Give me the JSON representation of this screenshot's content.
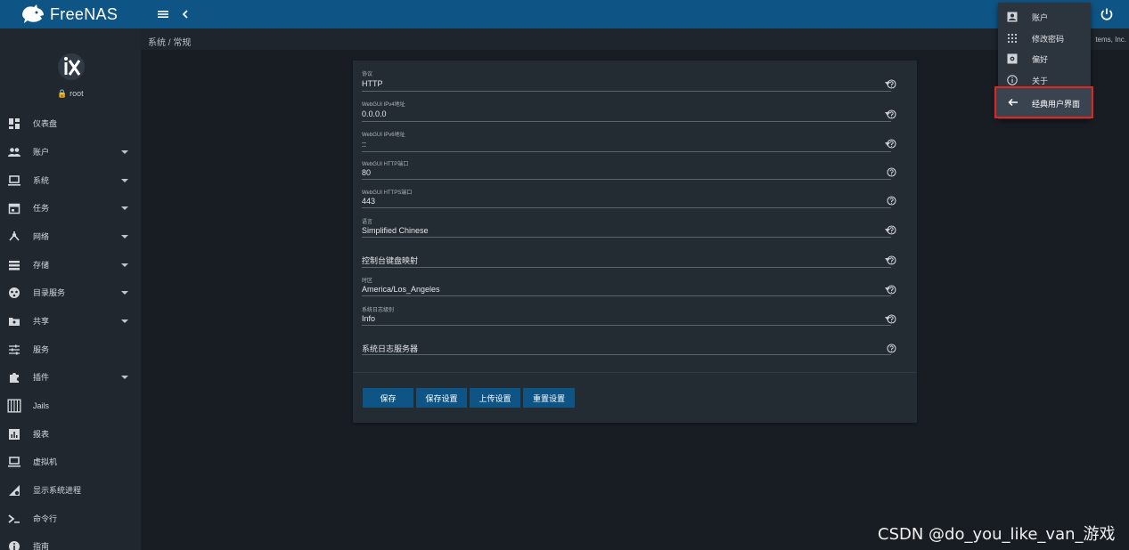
{
  "app": {
    "brand": "FreeNAS"
  },
  "sidebar": {
    "user": "root",
    "items": [
      {
        "label": "仪表盘",
        "icon": "dashboard-icon",
        "caret": false
      },
      {
        "label": "账户",
        "icon": "accounts-icon",
        "caret": true
      },
      {
        "label": "系统",
        "icon": "system-icon",
        "caret": true
      },
      {
        "label": "任务",
        "icon": "tasks-icon",
        "caret": true
      },
      {
        "label": "网络",
        "icon": "network-icon",
        "caret": true
      },
      {
        "label": "存储",
        "icon": "storage-icon",
        "caret": true
      },
      {
        "label": "目录服务",
        "icon": "directory-services-icon",
        "caret": true
      },
      {
        "label": "共享",
        "icon": "sharing-icon",
        "caret": true
      },
      {
        "label": "服务",
        "icon": "services-icon",
        "caret": false
      },
      {
        "label": "插件",
        "icon": "plugins-icon",
        "caret": true
      },
      {
        "label": "Jails",
        "icon": "jails-icon",
        "caret": false
      },
      {
        "label": "报表",
        "icon": "reporting-icon",
        "caret": false
      },
      {
        "label": "虚拟机",
        "icon": "virtual-machines-icon",
        "caret": false
      },
      {
        "label": "显示系统进程",
        "icon": "system-processes-icon",
        "caret": false
      },
      {
        "label": "命令行",
        "icon": "shell-icon",
        "caret": false
      },
      {
        "label": "指南",
        "icon": "guide-icon",
        "caret": false
      }
    ]
  },
  "breadcrumb": {
    "path": "系统 / 常规",
    "right_text": "tems, Inc."
  },
  "form": {
    "fields": [
      {
        "label": "协议",
        "value": "HTTP",
        "type": "select"
      },
      {
        "label": "WebGUI IPv4地址",
        "value": "0.0.0.0",
        "type": "select"
      },
      {
        "label": "WebGUI IPv6地址",
        "value": "::",
        "type": "select"
      },
      {
        "label": "WebGUI HTTP端口",
        "value": "80",
        "type": "input"
      },
      {
        "label": "WebGUI HTTPS端口",
        "value": "443",
        "type": "input"
      },
      {
        "label": "语言",
        "value": "Simplified Chinese",
        "type": "select"
      },
      {
        "label": "",
        "value": "控制台键盘映射",
        "type": "select"
      },
      {
        "label": "时区",
        "value": "America/Los_Angeles",
        "type": "select"
      },
      {
        "label": "系统日志级别",
        "value": "Info",
        "type": "select"
      },
      {
        "label": "",
        "value": "系统日志服务器",
        "type": "input"
      }
    ],
    "buttons": [
      "保存",
      "保存设置",
      "上传设置",
      "重置设置"
    ]
  },
  "user_menu": {
    "items": [
      {
        "label": "账户",
        "icon": "account-icon"
      },
      {
        "label": "修改密码",
        "icon": "password-dots-icon"
      },
      {
        "label": "偏好",
        "icon": "preferences-icon"
      },
      {
        "label": "关于",
        "icon": "info-icon"
      }
    ],
    "highlighted": {
      "label": "经典用户界面",
      "icon": "back-arrow-icon"
    }
  },
  "watermark": "CSDN @do_you_like_van_游戏",
  "colors": {
    "topbar": "#0e5585",
    "sidebar": "#20272f",
    "background": "#181d24",
    "card": "#232b33",
    "button": "#0e5585",
    "highlight_border": "#e0261f"
  }
}
